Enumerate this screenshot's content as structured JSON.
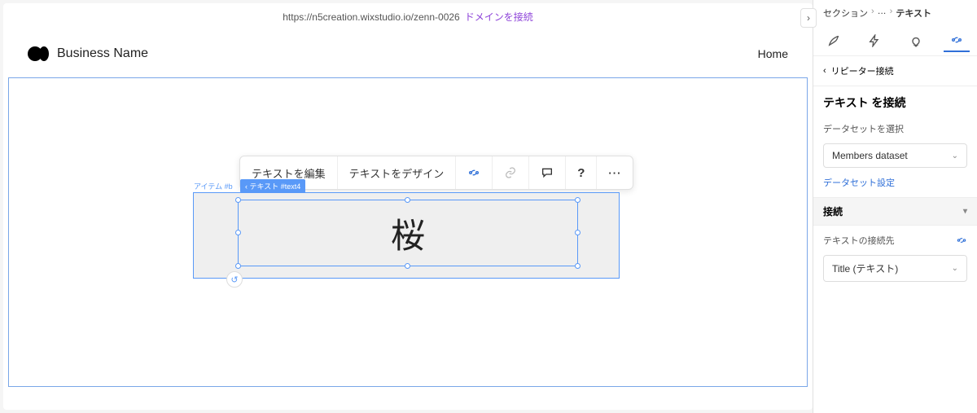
{
  "urlbar": {
    "url": "https://n5creation.wixstudio.io/zenn-0026",
    "domain_link": "ドメインを接続"
  },
  "header": {
    "business_name": "Business Name",
    "nav_home": "Home"
  },
  "toolbar": {
    "edit_text": "テキストを編集",
    "design_text": "テキストをデザイン"
  },
  "repeater": {
    "item_label": "アイテム #b",
    "text_label": "‹ テキスト #text4",
    "text_value": "桜"
  },
  "inspector": {
    "breadcrumb": {
      "root": "セクション",
      "mid": "…",
      "current": "テキスト"
    },
    "back_label": "リピーター接続",
    "panel_title": "テキスト を接続",
    "dataset_label": "データセットを選択",
    "dataset_value": "Members dataset",
    "dataset_settings": "データセット設定",
    "connection_header": "接続",
    "connect_label": "テキストの接続先",
    "connect_value": "Title (テキスト)"
  }
}
